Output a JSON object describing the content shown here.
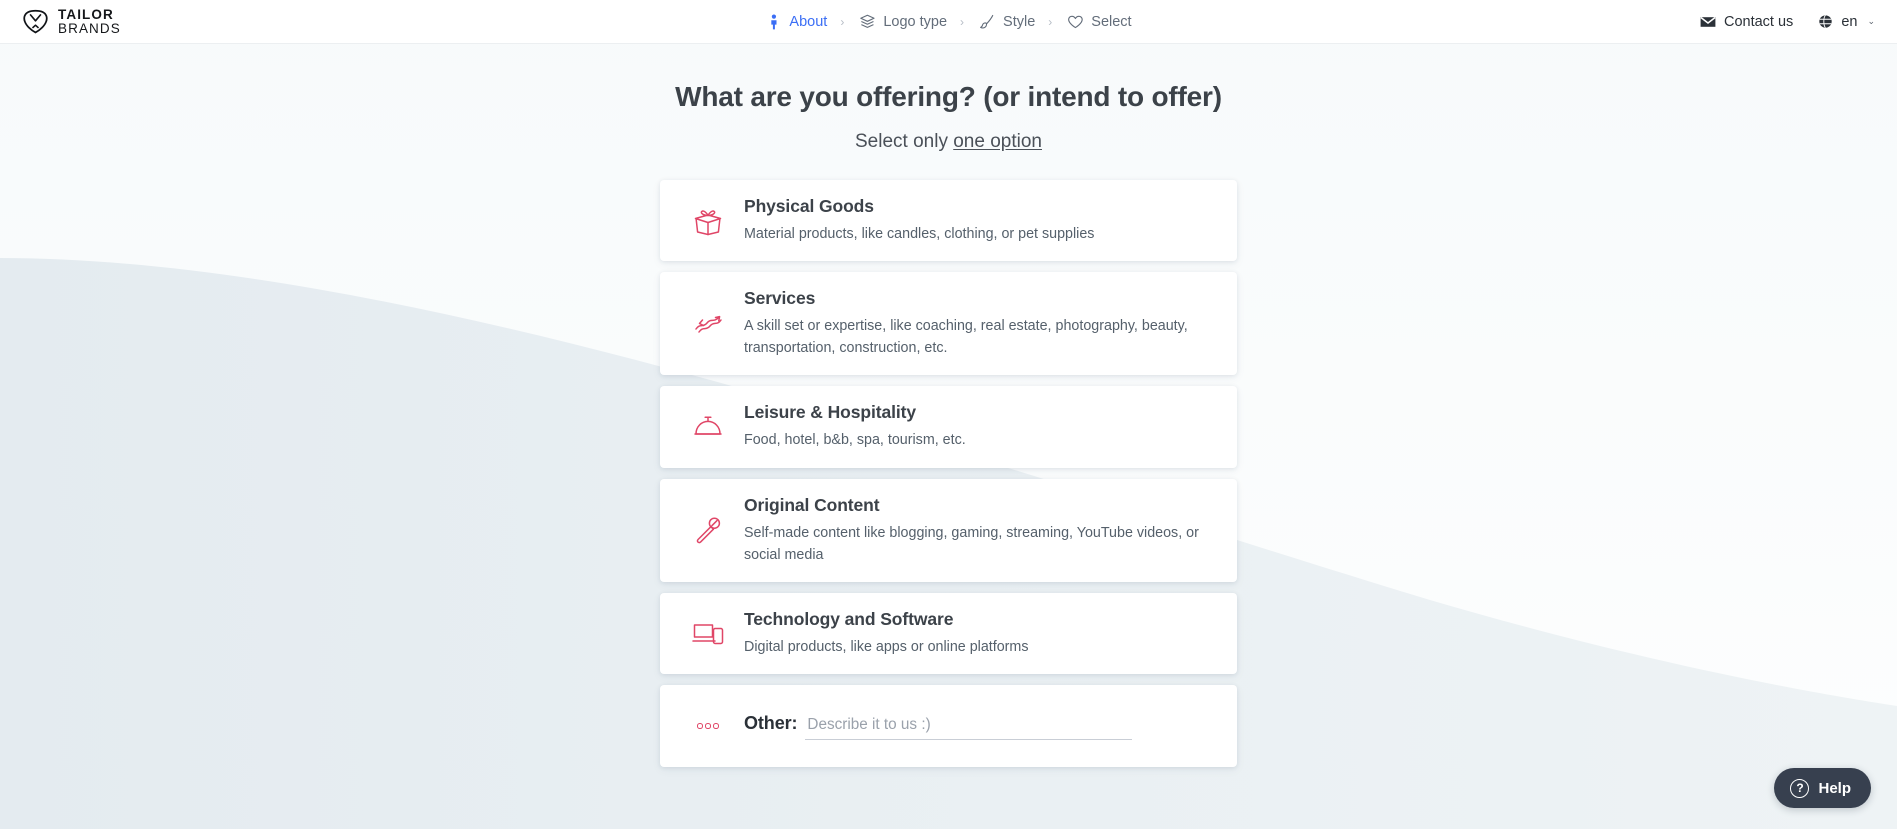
{
  "brand": {
    "logo_line1": "TAILOR",
    "logo_line2": "BRANDS",
    "logo_icon": "tailor-brands-shield-icon"
  },
  "header": {
    "steps": [
      {
        "label": "About",
        "icon": "person-icon",
        "active": true,
        "separator": "›"
      },
      {
        "label": "Logo type",
        "icon": "layers-icon",
        "active": false,
        "separator": "›"
      },
      {
        "label": "Style",
        "icon": "brush-icon",
        "active": false,
        "separator": "›"
      },
      {
        "label": "Select",
        "icon": "heart-icon",
        "active": false,
        "separator": ""
      }
    ],
    "contact": {
      "label": "Contact us",
      "icon": "envelope-icon"
    },
    "language": {
      "label": "en",
      "icon": "globe-icon",
      "chevron": "⌄"
    }
  },
  "main": {
    "title": "What are you offering? (or intend to offer)",
    "subtitle_prefix": "Select only ",
    "subtitle_link": "one option",
    "options": [
      {
        "title": "Physical Goods",
        "desc": "Material products, like candles, clothing, or pet supplies",
        "icon": "gift-box-icon"
      },
      {
        "title": "Services",
        "desc": "A skill set or expertise, like coaching, real estate, photography, beauty, transportation, construction, etc.",
        "icon": "services-squiggle-icon"
      },
      {
        "title": "Leisure & Hospitality",
        "desc": "Food, hotel, b&b, spa, tourism, etc.",
        "icon": "service-bell-icon"
      },
      {
        "title": "Original Content",
        "desc": "Self-made content like blogging, gaming, streaming, YouTube videos, or social media",
        "icon": "microphone-icon"
      },
      {
        "title": "Technology and Software",
        "desc": "Digital products, like apps or online platforms",
        "icon": "devices-icon"
      }
    ],
    "other": {
      "label": "Other:",
      "placeholder": "Describe it to us :)",
      "value": "",
      "icon": "three-dots-icon"
    }
  },
  "help_widget": {
    "label": "Help",
    "icon": "question-circle-icon",
    "symbol": "?"
  },
  "colors": {
    "accent_pink": "#e04667",
    "active_blue": "#3b6ef5",
    "text_dark": "#3c4249",
    "help_bg": "#37404f"
  }
}
